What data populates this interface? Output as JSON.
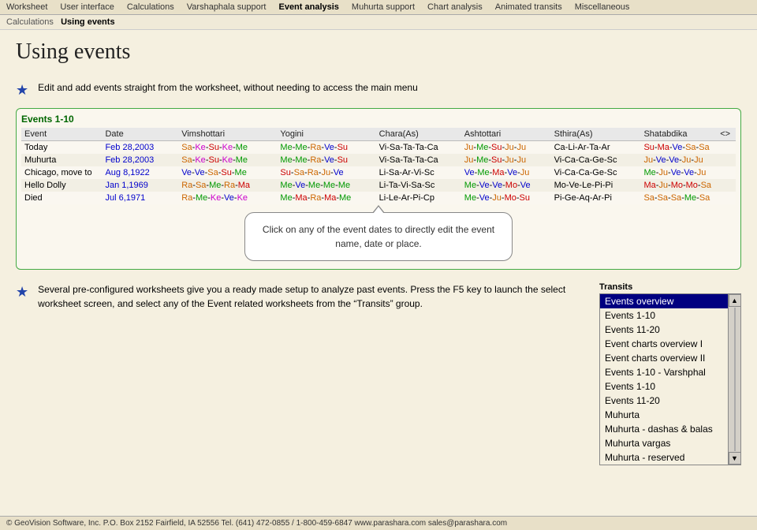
{
  "nav": {
    "items": [
      {
        "label": "Worksheet",
        "active": false
      },
      {
        "label": "User interface",
        "active": false
      },
      {
        "label": "Calculations",
        "active": false
      },
      {
        "label": "Varshaphala support",
        "active": false
      },
      {
        "label": "Event analysis",
        "active": true
      },
      {
        "label": "Muhurta support",
        "active": false
      },
      {
        "label": "Chart analysis",
        "active": false
      },
      {
        "label": "Animated transits",
        "active": false
      },
      {
        "label": "Miscellaneous",
        "active": false
      }
    ]
  },
  "breadcrumb": {
    "parent": "Calculations",
    "current": "Using events"
  },
  "page": {
    "title": "Using events"
  },
  "section1": {
    "text": "Edit and add events straight from the worksheet, without needing to access the main menu"
  },
  "events_table": {
    "title": "Events 1-10",
    "columns": [
      "Event",
      "Date",
      "Vimshottari",
      "Yogini",
      "Chara(As)",
      "Ashtottari",
      "Sthira(As)",
      "Shatabdika",
      "<>"
    ],
    "rows": [
      {
        "event": "Today",
        "date": "Feb 28,2003",
        "vims": "Sa-Ke-Su-Ke-Me",
        "yogini": "Me-Me-Ra-Ve-Su",
        "chara": "Vi-Sa-Ta-Ta-Ca",
        "ashtot": "Ju-Me-Su-Ju-Ju",
        "sthira": "Ca-Li-Ar-Ta-Ar",
        "shat": "Su-Ma-Ve-Sa-Sa"
      },
      {
        "event": "Muhurta",
        "date": "Feb 28,2003",
        "vims": "Sa-Ke-Su-Ke-Me",
        "yogini": "Me-Me-Ra-Ve-Su",
        "chara": "Vi-Sa-Ta-Ta-Ca",
        "ashtot": "Ju-Me-Su-Ju-Ju",
        "sthira": "Vi-Ca-Ca-Ge-Sc",
        "shat": "Ju-Ve-Ve-Ju-Ju"
      },
      {
        "event": "Chicago, move to",
        "date": "Aug 8,1922",
        "vims": "Ve-Ve-Sa-Su-Me",
        "yogini": "Su-Sa-Ra-Ju-Ve",
        "chara": "Li-Sa-Ar-Vi-Sc",
        "ashtot": "Ve-Me-Ma-Ve-Ju",
        "sthira": "Vi-Ca-Ca-Ge-Sc",
        "shat": "Me-Ju-Ve-Ve-Ju"
      },
      {
        "event": "Hello Dolly",
        "date": "Jan 1,1969",
        "vims": "Ra-Sa-Me-Ra-Ma",
        "yogini": "Me-Ve-Me-Me-Me",
        "chara": "Li-Ta-Vi-Sa-Sc",
        "ashtot": "Me-Ve-Ve-Mo-Ve",
        "sthira": "Mo-Ve-Le-Pi-Pi",
        "shat": "Ma-Ju-Mo-Mo-Sa"
      },
      {
        "event": "Died",
        "date": "Jul 6,1971",
        "vims": "Ra-Me-Ke-Ve-Ke",
        "yogini": "Me-Ma-Ra-Ma-Me",
        "chara": "Li-Le-Ar-Pi-Cp",
        "ashtot": "Me-Ve-Ju-Mo-Su",
        "sthira": "Pi-Ge-Aq-Ar-Pi",
        "shat": "Sa-Sa-Sa-Me-Sa"
      }
    ]
  },
  "callout": {
    "text": "Click on any of the event dates to directly edit the event name, date or place."
  },
  "section2": {
    "text": "Several pre-configured worksheets give you a ready made setup to analyze past events. Press the F5 key to launch the select worksheet screen, and select any of the Event related worksheets from the “Transits” group."
  },
  "transits": {
    "title": "Transits",
    "items": [
      {
        "label": "Events overview",
        "selected": true
      },
      {
        "label": "Events 1-10",
        "selected": false
      },
      {
        "label": "Events 11-20",
        "selected": false
      },
      {
        "label": "Event charts overview I",
        "selected": false
      },
      {
        "label": "Event charts overview II",
        "selected": false
      },
      {
        "label": "Events 1-10 - Varshphal",
        "selected": false
      },
      {
        "label": "Events 1-10",
        "selected": false
      },
      {
        "label": "Events 11-20",
        "selected": false
      },
      {
        "label": "Muhurta",
        "selected": false
      },
      {
        "label": "Muhurta - dashas & balas",
        "selected": false
      },
      {
        "label": "Muhurta vargas",
        "selected": false
      },
      {
        "label": "Muhurta - reserved",
        "selected": false
      }
    ]
  },
  "footer": {
    "text": "© GeoVision Software, Inc. P.O. Box 2152 Fairfield, IA 52556    Tel. (641) 472-0855 / 1-800-459-6847    www.parashara.com    sales@parashara.com"
  }
}
